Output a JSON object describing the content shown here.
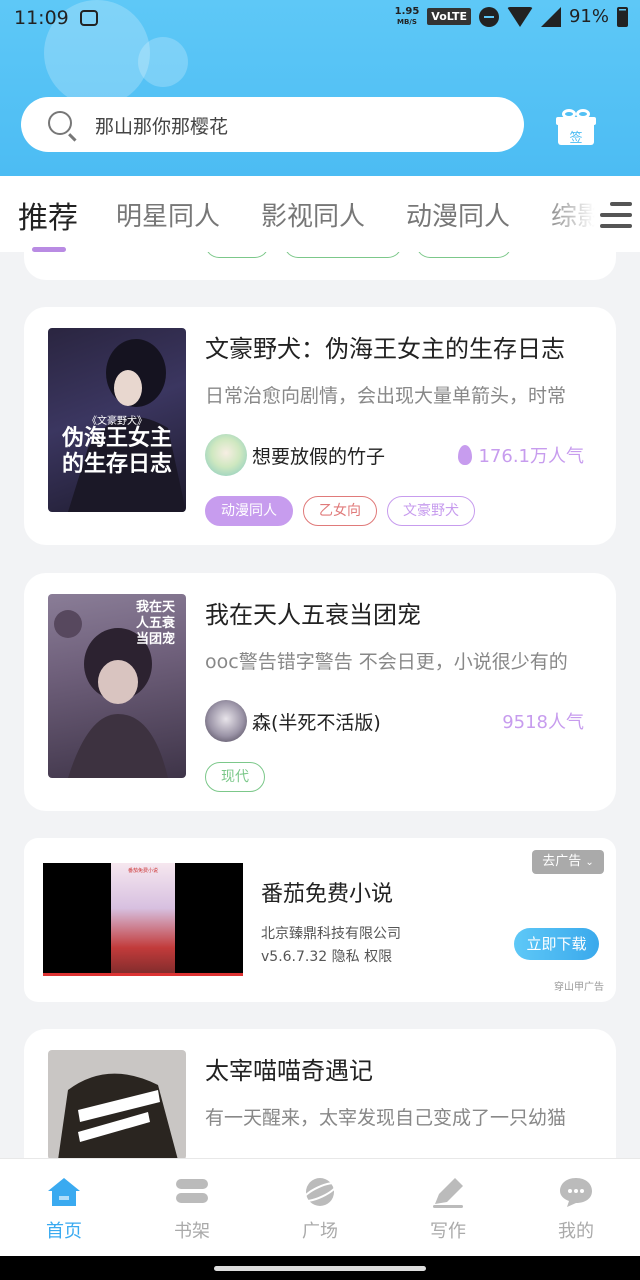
{
  "status": {
    "time": "11:09",
    "speed": "1.95",
    "speed_unit": "MB/S",
    "volte": "VoLTE",
    "battery": "91%"
  },
  "search": {
    "placeholder": "那山那你那樱花"
  },
  "gift": {
    "label": "签"
  },
  "tabs": [
    {
      "label": "推荐",
      "active": true
    },
    {
      "label": "明星同人"
    },
    {
      "label": "影视同人"
    },
    {
      "label": "动漫同人"
    },
    {
      "label": "综影"
    }
  ],
  "partial_card": {
    "tags": [
      "",
      "",
      ""
    ]
  },
  "books": [
    {
      "title": "文豪野犬：伪海王女主的生存日志",
      "desc": "日常治愈向剧情，会出现大量单箭头，时常",
      "author": "想要放假的竹子",
      "popularity": "176.1万人气",
      "tags": [
        "动漫同人",
        "乙女向",
        "文豪野犬"
      ],
      "cover_text_top": "《文豪野犬》",
      "cover_text_main": "伪海王女主的生存日志"
    },
    {
      "title": "我在天人五衰当团宠",
      "desc": "ooc警告错字警告 不会日更，小说很少有的",
      "author": "森(半死不活版)",
      "popularity": "9518人气",
      "tags": [
        "现代"
      ],
      "cover_text_main": "我在天人五衰当团宠"
    },
    {
      "title": "太宰喵喵奇遇记",
      "desc": "有一天醒来，太宰发现自己变成了一只幼猫"
    }
  ],
  "ad": {
    "title": "番茄免费小说",
    "company": "北京臻鼎科技有限公司",
    "meta": "v5.6.7.32  隐私  权限",
    "close": "去广告",
    "download": "立即下载",
    "source": "穿山甲广告",
    "media_label": "番茄免费小说"
  },
  "nav": [
    {
      "label": "首页",
      "icon": "home-icon",
      "active": true
    },
    {
      "label": "书架",
      "icon": "bookshelf-icon"
    },
    {
      "label": "广场",
      "icon": "planet-icon"
    },
    {
      "label": "写作",
      "icon": "pen-icon"
    },
    {
      "label": "我的",
      "icon": "chat-bubble-icon"
    }
  ],
  "colors": {
    "accent": "#4cbcf3",
    "tag_purple": "#c79cee",
    "tag_red": "#e07a7a",
    "tag_green": "#7cc88a",
    "nav_active": "#3aaaf0"
  }
}
